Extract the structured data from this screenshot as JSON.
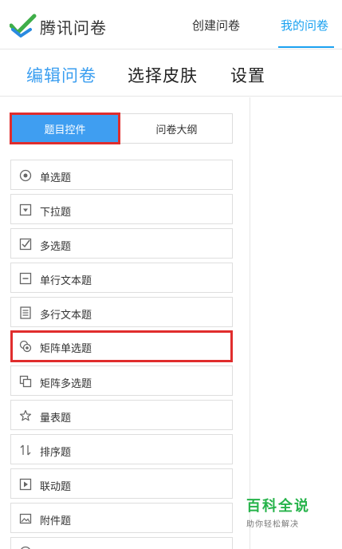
{
  "header": {
    "brand": "腾讯问卷",
    "nav": {
      "create": "创建问卷",
      "mine": "我的问卷"
    }
  },
  "tabs": {
    "edit": "编辑问卷",
    "skin": "选择皮肤",
    "settings": "设置"
  },
  "segments": {
    "active": "题目控件",
    "inactive": "问卷大纲"
  },
  "question_types": [
    {
      "label": "单选题",
      "icon": "radio-icon"
    },
    {
      "label": "下拉题",
      "icon": "dropdown-icon"
    },
    {
      "label": "多选题",
      "icon": "checkbox-icon"
    },
    {
      "label": "单行文本题",
      "icon": "single-line-text-icon"
    },
    {
      "label": "多行文本题",
      "icon": "multi-line-text-icon"
    },
    {
      "label": "矩阵单选题",
      "icon": "matrix-radio-icon"
    },
    {
      "label": "矩阵多选题",
      "icon": "matrix-checkbox-icon"
    },
    {
      "label": "量表题",
      "icon": "star-icon"
    },
    {
      "label": "排序题",
      "icon": "sort-icon"
    },
    {
      "label": "联动题",
      "icon": "linkage-icon"
    },
    {
      "label": "附件题",
      "icon": "attachment-image-icon"
    }
  ],
  "watermark": {
    "title": "百科全说",
    "subtitle": "助你轻松解决"
  },
  "colors": {
    "accent": "#3f9ef1",
    "highlight_border": "#e02d2d",
    "nav_active": "#1aa1f0",
    "watermark": "#26b34a"
  }
}
